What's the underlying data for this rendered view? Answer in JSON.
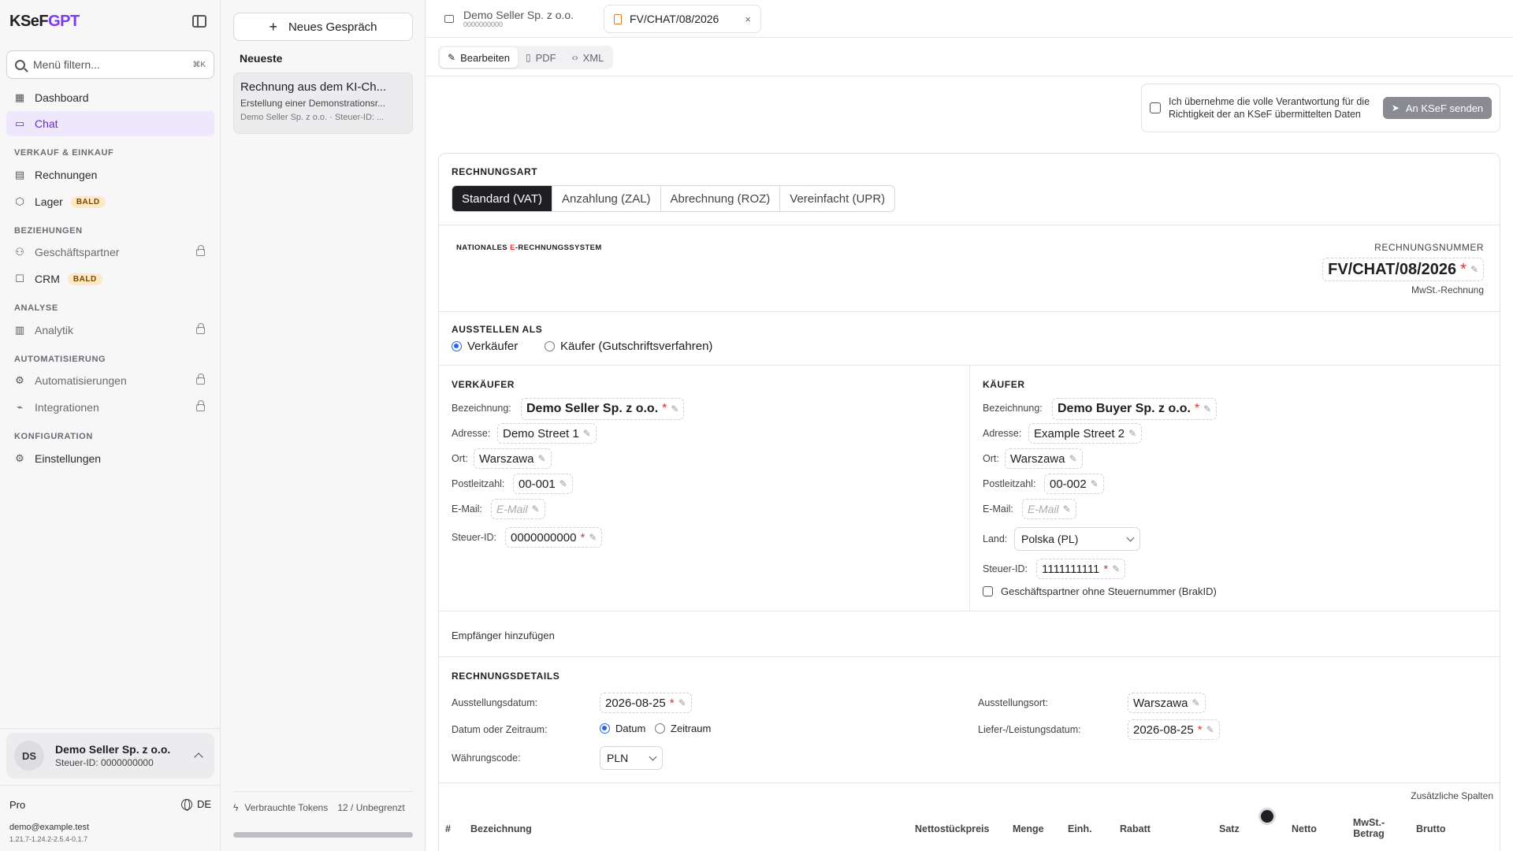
{
  "sidebar": {
    "logo": {
      "prefix": "KSeF",
      "suffix": "GPT"
    },
    "filter": {
      "placeholder": "Menü filtern...",
      "shortcut": "⌘K"
    },
    "items": {
      "dashboard": "Dashboard",
      "chat": "Chat",
      "rechnungen": "Rechnungen",
      "lager": "Lager",
      "partner": "Geschäftspartner",
      "crm": "CRM",
      "analytik": "Analytik",
      "automatisierungen": "Automatisierungen",
      "integrationen": "Integrationen",
      "einstellungen": "Einstellungen"
    },
    "badge_soon": "BALD",
    "sections": {
      "verkauf": "VERKAUF & EINKAUF",
      "beziehungen": "BEZIEHUNGEN",
      "analyse": "ANALYSE",
      "automatisierung": "AUTOMATISIERUNG",
      "konfiguration": "KONFIGURATION"
    },
    "user": {
      "initials": "DS",
      "name": "Demo Seller Sp. z o.o.",
      "tax_id": "Steuer-ID: 0000000000"
    },
    "plan": "Pro",
    "language": "DE",
    "email": "demo@example.test",
    "version": "1.21.7-1.24.2-2.5.4-0.1.7"
  },
  "chatlist": {
    "new_chat": "Neues Gespräch",
    "recent": "Neueste",
    "chats": [
      {
        "title": "Rechnung aus dem KI-Ch...",
        "subtitle": "Erstellung einer Demonstrationsr...",
        "meta": "Demo Seller Sp. z o.o. · Steuer-ID: ..."
      }
    ],
    "tokens_label": "Verbrauchte Tokens",
    "tokens_value": "12 / Unbegrenzt"
  },
  "tabs": {
    "tab1": {
      "title": "Demo Seller Sp. z o.o.",
      "subtitle": "0000000000"
    },
    "tab2": {
      "title": "FV/CHAT/08/2026",
      "close": "×"
    }
  },
  "modes": {
    "edit": "Bearbeiten",
    "pdf": "PDF",
    "xml": "XML"
  },
  "consent": {
    "text": "Ich übernehme die volle Verantwortung für die Richtigkeit der an KSeF übermittelten Daten",
    "send": "An KSeF senden"
  },
  "invoice": {
    "type_heading": "RECHNUNGSART",
    "types": [
      "Standard (VAT)",
      "Anzahlung (ZAL)",
      "Abrechnung (ROZ)",
      "Vereinfacht (UPR)"
    ],
    "natsys": {
      "a": "NATIONALES ",
      "e": "E",
      "b": "-RECHNUNGSSYSTEM"
    },
    "number_label": "RECHNUNGSNUMMER",
    "number": "FV/CHAT/08/2026",
    "number_sub": "MwSt.-Rechnung",
    "issue_as_heading": "AUSSTELLEN ALS",
    "issue_as": {
      "seller": "Verkäufer",
      "buyer": "Käufer (Gutschriftsverfahren)"
    },
    "seller": {
      "heading": "VERKÄUFER",
      "labels": {
        "name": "Bezeichnung:",
        "address": "Adresse:",
        "city": "Ort:",
        "zip": "Postleitzahl:",
        "email": "E-Mail:",
        "tax": "Steuer-ID:"
      },
      "name": "Demo Seller Sp. z o.o.",
      "address": "Demo Street 1",
      "city": "Warszawa",
      "zip": "00-001",
      "email_placeholder": "E-Mail",
      "tax": "0000000000"
    },
    "buyer": {
      "heading": "KÄUFER",
      "labels": {
        "name": "Bezeichnung:",
        "address": "Adresse:",
        "city": "Ort:",
        "zip": "Postleitzahl:",
        "email": "E-Mail:",
        "country": "Land:",
        "tax": "Steuer-ID:"
      },
      "name": "Demo Buyer Sp. z o.o.",
      "address": "Example Street 2",
      "city": "Warszawa",
      "zip": "00-002",
      "email_placeholder": "E-Mail",
      "country": "Polska (PL)",
      "tax": "1111111111",
      "no_tax_label": "Geschäftspartner ohne Steuernummer (BrakID)"
    },
    "add_recipient": "Empfänger hinzufügen",
    "details": {
      "heading": "RECHNUNGSDETAILS",
      "issue_date_label": "Ausstellungsdatum:",
      "issue_date": "2026-08-25",
      "date_mode_label": "Datum oder Zeitraum:",
      "date_mode": {
        "date": "Datum",
        "range": "Zeitraum"
      },
      "currency_label": "Währungscode:",
      "currency": "PLN",
      "issue_place_label": "Ausstellungsort:",
      "issue_place": "Warszawa",
      "delivery_date_label": "Liefer-/Leistungsdatum:",
      "delivery_date": "2026-08-25"
    },
    "extra_columns": "Zusätzliche Spalten",
    "table_headers": {
      "num": "#",
      "name": "Bezeichnung",
      "net_unit": "Nettostückpreis",
      "qty": "Menge",
      "unit": "Einh.",
      "discount": "Rabatt",
      "rate": "Satz",
      "net": "Netto",
      "vat": "MwSt.-Betrag",
      "gross": "Brutto"
    }
  },
  "colors": {
    "accent": "#7c3aed",
    "active_bg": "#efe7fb",
    "dark": "#1f1f23",
    "required": "#e03030"
  }
}
